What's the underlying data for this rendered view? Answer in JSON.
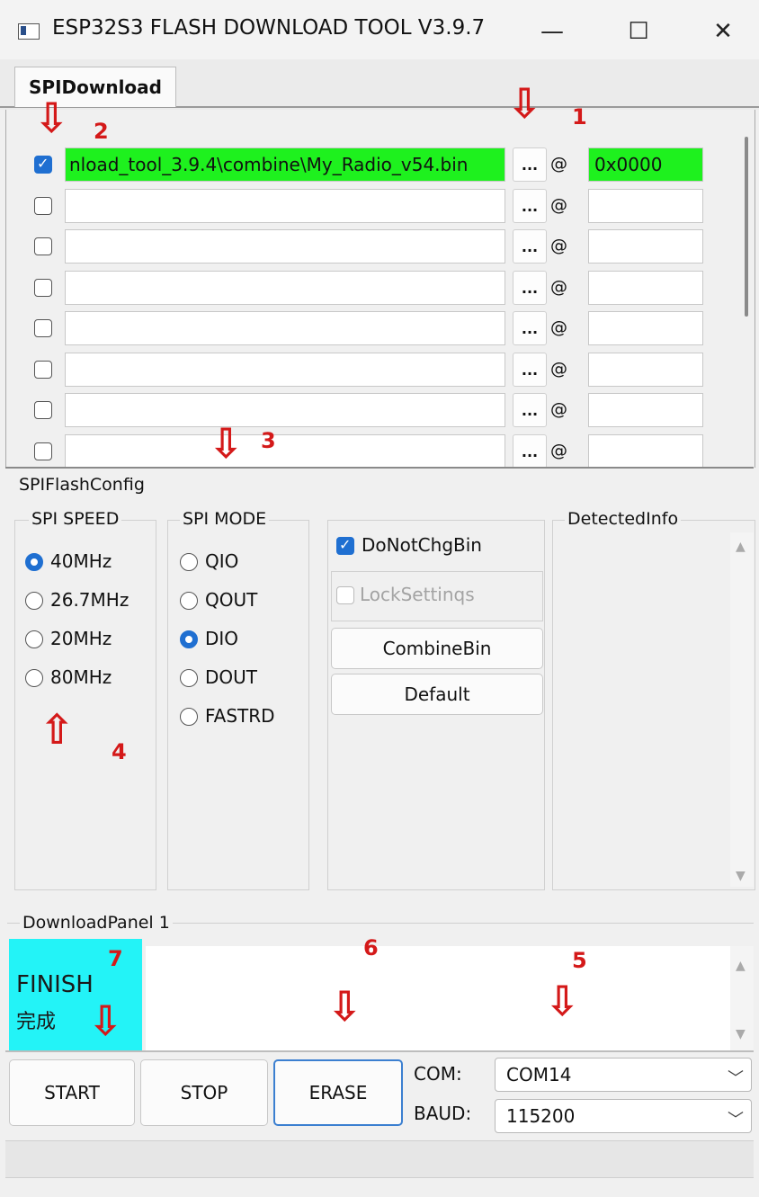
{
  "window": {
    "title": "ESP32S3 FLASH DOWNLOAD TOOL V3.9.7",
    "minimize_glyph": "—",
    "maximize_glyph": "☐",
    "close_glyph": "✕"
  },
  "tab": {
    "label": "SPIDownload"
  },
  "files": {
    "browse_label": "...",
    "at_label": "@",
    "rows": [
      {
        "checked": true,
        "path": "nload_tool_3.9.4\\combine\\My_Radio_v54.bin",
        "addr": "0x0000"
      },
      {
        "checked": false,
        "path": "",
        "addr": ""
      },
      {
        "checked": false,
        "path": "",
        "addr": ""
      },
      {
        "checked": false,
        "path": "",
        "addr": ""
      },
      {
        "checked": false,
        "path": "",
        "addr": ""
      },
      {
        "checked": false,
        "path": "",
        "addr": ""
      },
      {
        "checked": false,
        "path": "",
        "addr": ""
      },
      {
        "checked": false,
        "path": "",
        "addr": ""
      }
    ]
  },
  "config": {
    "title": "SPIFlashConfig",
    "spi_speed": {
      "title": "SPI SPEED",
      "options": [
        "40MHz",
        "26.7MHz",
        "20MHz",
        "80MHz"
      ],
      "selected": "40MHz"
    },
    "spi_mode": {
      "title": "SPI MODE",
      "options": [
        "QIO",
        "QOUT",
        "DIO",
        "DOUT",
        "FASTRD"
      ],
      "selected": "DIO"
    },
    "do_not_chg_bin": {
      "label": "DoNotChgBin",
      "checked": true
    },
    "lock_settings": {
      "label": "LockSettinqs",
      "checked": false
    },
    "combine_bin_label": "CombineBin",
    "default_label": "Default",
    "detected_info_title": "DetectedInfo"
  },
  "download_panel": {
    "title": "DownloadPanel 1",
    "status_en": "FINISH",
    "status_cn": "完成",
    "start_label": "START",
    "stop_label": "STOP",
    "erase_label": "ERASE",
    "com_label": "COM:",
    "com_value": "COM14",
    "baud_label": "BAUD:",
    "baud_value": "115200"
  },
  "annotations": {
    "arrow_glyph": "⇩",
    "up_arrow_glyph": "⇧",
    "labels": [
      "1",
      "2",
      "3",
      "4",
      "5",
      "6",
      "7"
    ]
  },
  "colors": {
    "highlight_green": "#1ef11e",
    "finish_cyan": "#23f3f7",
    "accent_blue": "#1f6fd1",
    "annotation_red": "#d41919"
  }
}
